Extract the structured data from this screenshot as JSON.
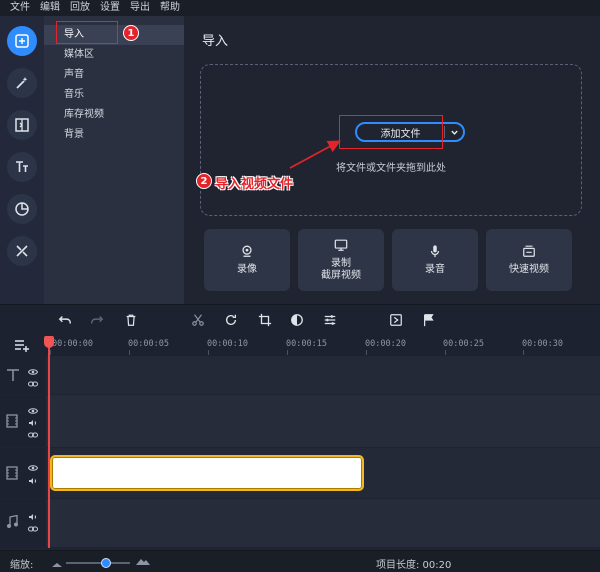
{
  "menu": [
    "文件",
    "编辑",
    "回放",
    "设置",
    "导出",
    "帮助"
  ],
  "rail": {
    "items": [
      {
        "icon": "import-icon",
        "active": true
      },
      {
        "icon": "magic-wand-icon",
        "active": false
      },
      {
        "icon": "transitions-icon",
        "active": false
      },
      {
        "icon": "text-icon",
        "active": false
      },
      {
        "icon": "stickers-icon",
        "active": false
      },
      {
        "icon": "tools-icon",
        "active": false
      }
    ]
  },
  "categories": [
    "导入",
    "媒体区",
    "声音",
    "音乐",
    "库存视频",
    "背景"
  ],
  "annotations": {
    "step1": "1",
    "step2": "2",
    "step2_label": "导入视频文件"
  },
  "main": {
    "title": "导入",
    "add_button": "添加文件",
    "drop_hint": "将文件或文件夹拖到此处",
    "tiles": [
      {
        "icon": "webcam-icon",
        "label": "录像"
      },
      {
        "icon": "screen-record-icon",
        "label": "录制\n截屏视频"
      },
      {
        "icon": "microphone-icon",
        "label": "录音"
      },
      {
        "icon": "quick-video-icon",
        "label": "快速视频"
      }
    ]
  },
  "ruler": [
    "00:00:00",
    "00:00:05",
    "00:00:10",
    "00:00:15",
    "00:00:20",
    "00:00:25",
    "00:00:30"
  ],
  "status": {
    "zoom_label": "缩放:",
    "project_length": "项目长度: 00:20"
  },
  "colors": {
    "accent": "#2f8cff",
    "annotation": "#e4242b",
    "clip_border": "#f2b820",
    "playhead": "#e84545"
  }
}
